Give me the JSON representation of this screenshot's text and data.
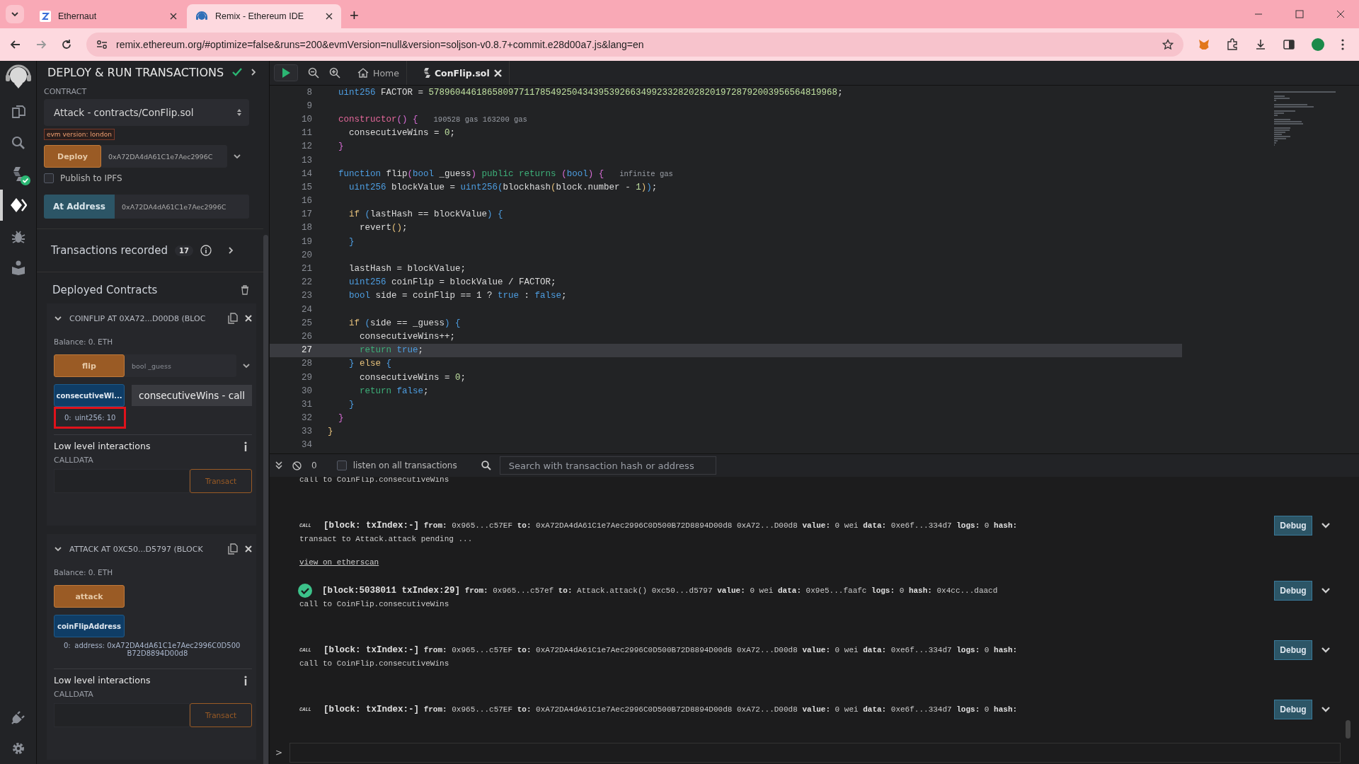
{
  "browser": {
    "tabs": [
      {
        "kind": "ethernaut",
        "title": "Ethernaut",
        "selected": false
      },
      {
        "kind": "remix",
        "title": "Remix - Ethereum IDE",
        "selected": true
      }
    ],
    "new_tab": "+",
    "url": "remix.ethereum.org/#optimize=false&runs=200&evmVersion=null&version=soljson-v0.8.7+commit.e28d00a7.js&lang=en"
  },
  "icon_panel": {
    "items": [
      {
        "kind": "files",
        "selected": false,
        "badge": false
      },
      {
        "kind": "search",
        "selected": false,
        "badge": false
      },
      {
        "kind": "compiler",
        "selected": false,
        "badge": true
      },
      {
        "kind": "deploy",
        "selected": true,
        "badge": false
      },
      {
        "kind": "debugger",
        "selected": false,
        "badge": false
      },
      {
        "kind": "learn",
        "selected": false,
        "badge": false
      }
    ],
    "bottom": [
      {
        "kind": "plugins"
      },
      {
        "kind": "settings"
      }
    ]
  },
  "side_panel": {
    "title": "DEPLOY & RUN TRANSACTIONS",
    "contract_label": "CONTRACT",
    "contract": "Attack - contracts/ConFlip.sol",
    "evm_badge": "evm version: london",
    "deploy": {
      "label": "Deploy",
      "value": "0xA72DA4dA61C1e7Aec2996C"
    },
    "publish": {
      "label": "Publish to IPFS",
      "checked": false
    },
    "at_address": {
      "label": "At Address",
      "value": "0xA72DA4dA61C1e7Aec2996C"
    },
    "transactions": {
      "label": "Transactions recorded",
      "count": "17"
    },
    "deployed_title": "Deployed Contracts",
    "instances": [
      {
        "title": "COINFLIP AT 0XA72...D00D8 (BLOC",
        "expanded": true,
        "balance": "Balance: 0. ETH",
        "functions": [
          {
            "kind": "transact",
            "label": "flip",
            "placeholder": "bool _guess"
          },
          {
            "kind": "call",
            "label": "consecutiveWi...",
            "tooltip": "consecutiveWins - call",
            "result_key": "0:",
            "result": "uint256: 10",
            "highlighted": true
          }
        ],
        "low_level": "Low level interactions",
        "calldata_label": "CALLDATA",
        "transact": "Transact"
      },
      {
        "title": "ATTACK AT 0XC50...D5797 (BLOCK",
        "expanded": true,
        "balance": "Balance: 0. ETH",
        "functions": [
          {
            "kind": "transact",
            "label": "attack"
          },
          {
            "kind": "call",
            "label": "coinFlipAddress",
            "result_key": "0:",
            "result": "address: 0xA72DA4dA61C1e7Aec2996C0D500B72D8894D00d8",
            "highlighted": false
          }
        ],
        "low_level": "Low level interactions",
        "calldata_label": "CALLDATA",
        "transact": "Transact"
      }
    ]
  },
  "editor": {
    "tabs": [
      {
        "kind": "home",
        "label": "Home",
        "selected": false
      },
      {
        "kind": "file",
        "label": "ConFlip.sol",
        "selected": true
      }
    ],
    "lines": [
      {
        "number": "8",
        "current": false,
        "tokens": [
          {
            "text": "  uint256",
            "kind": "type"
          },
          {
            "text": " FACTOR = ",
            "kind": "plain"
          },
          {
            "text": "57896044618658097711785492504343953926634992332820282019728792003956564819968",
            "kind": "number"
          },
          {
            "text": ";",
            "kind": "plain"
          }
        ]
      },
      {
        "number": "9",
        "current": false
      },
      {
        "number": "10",
        "current": false,
        "tokens": [
          {
            "text": "  constructor",
            "kind": "ctor"
          },
          {
            "text": "()",
            "kind": "bracket1"
          },
          {
            "text": " {",
            "kind": "bracket1"
          }
        ],
        "hint": "190528 gas 163200 gas"
      },
      {
        "number": "11",
        "current": false,
        "tokens": [
          {
            "text": "    consecutiveWins = ",
            "kind": "plain"
          },
          {
            "text": "0",
            "kind": "number"
          },
          {
            "text": ";",
            "kind": "plain"
          }
        ]
      },
      {
        "number": "12",
        "current": false,
        "tokens": [
          {
            "text": "  }",
            "kind": "bracket1"
          }
        ]
      },
      {
        "number": "13",
        "current": false
      },
      {
        "number": "14",
        "current": false,
        "tokens": [
          {
            "text": "  function",
            "kind": "type"
          },
          {
            "text": " flip",
            "kind": "plain"
          },
          {
            "text": "(",
            "kind": "bracket1"
          },
          {
            "text": "bool",
            "kind": "type"
          },
          {
            "text": " _guess",
            "kind": "plain"
          },
          {
            "text": ")",
            "kind": "bracket1"
          },
          {
            "text": " public returns ",
            "kind": "modifier"
          },
          {
            "text": "(",
            "kind": "bracket1"
          },
          {
            "text": "bool",
            "kind": "type"
          },
          {
            "text": ")",
            "kind": "bracket1"
          },
          {
            "text": " {",
            "kind": "bracket1"
          }
        ],
        "hint": "infinite gas"
      },
      {
        "number": "15",
        "current": false,
        "tokens": [
          {
            "text": "    uint256",
            "kind": "type"
          },
          {
            "text": " blockValue = ",
            "kind": "plain"
          },
          {
            "text": "uint256",
            "kind": "type"
          },
          {
            "text": "(",
            "kind": "bracket2"
          },
          {
            "text": "blockhash",
            "kind": "plain"
          },
          {
            "text": "(",
            "kind": "bracket3"
          },
          {
            "text": "block.number - ",
            "kind": "plain"
          },
          {
            "text": "1",
            "kind": "number"
          },
          {
            "text": ")",
            "kind": "bracket3"
          },
          {
            "text": ")",
            "kind": "bracket2"
          },
          {
            "text": ";",
            "kind": "plain"
          }
        ]
      },
      {
        "number": "16",
        "current": false
      },
      {
        "number": "17",
        "current": false,
        "tokens": [
          {
            "text": "    if",
            "kind": "control"
          },
          {
            "text": " (",
            "kind": "bracket2"
          },
          {
            "text": "lastHash == blockValue",
            "kind": "plain"
          },
          {
            "text": ")",
            "kind": "bracket2"
          },
          {
            "text": " {",
            "kind": "bracket2"
          }
        ]
      },
      {
        "number": "18",
        "current": false,
        "tokens": [
          {
            "text": "      revert",
            "kind": "plain"
          },
          {
            "text": "()",
            "kind": "bracket3"
          },
          {
            "text": ";",
            "kind": "plain"
          }
        ]
      },
      {
        "number": "19",
        "current": false,
        "tokens": [
          {
            "text": "    }",
            "kind": "bracket2"
          }
        ]
      },
      {
        "number": "20",
        "current": false
      },
      {
        "number": "21",
        "current": false,
        "tokens": [
          {
            "text": "    lastHash = blockValue;",
            "kind": "plain"
          }
        ]
      },
      {
        "number": "22",
        "current": false,
        "tokens": [
          {
            "text": "    uint256",
            "kind": "type"
          },
          {
            "text": " coinFlip = blockValue / FACTOR;",
            "kind": "plain"
          }
        ]
      },
      {
        "number": "23",
        "current": false,
        "tokens": [
          {
            "text": "    bool",
            "kind": "type"
          },
          {
            "text": " side = coinFlip == 1 ? ",
            "kind": "plain"
          },
          {
            "text": "true",
            "kind": "type"
          },
          {
            "text": " : ",
            "kind": "plain"
          },
          {
            "text": "false",
            "kind": "type"
          },
          {
            "text": ";",
            "kind": "plain"
          }
        ]
      },
      {
        "number": "24",
        "current": false
      },
      {
        "number": "25",
        "current": false,
        "tokens": [
          {
            "text": "    if",
            "kind": "control"
          },
          {
            "text": " (",
            "kind": "bracket2"
          },
          {
            "text": "side == _guess",
            "kind": "plain"
          },
          {
            "text": ")",
            "kind": "bracket2"
          },
          {
            "text": " {",
            "kind": "bracket2"
          }
        ]
      },
      {
        "number": "26",
        "current": false,
        "tokens": [
          {
            "text": "      consecutiveWins++;",
            "kind": "plain"
          }
        ]
      },
      {
        "number": "27",
        "current": true,
        "tokens": [
          {
            "text": "      return",
            "kind": "modifier"
          },
          {
            "text": " true",
            "kind": "type"
          },
          {
            "text": ";",
            "kind": "plain"
          }
        ]
      },
      {
        "number": "28",
        "current": false,
        "tokens": [
          {
            "text": "    }",
            "kind": "bracket2"
          },
          {
            "text": " else",
            "kind": "control"
          },
          {
            "text": " {",
            "kind": "bracket2"
          }
        ]
      },
      {
        "number": "29",
        "current": false,
        "tokens": [
          {
            "text": "      consecutiveWins = ",
            "kind": "plain"
          },
          {
            "text": "0",
            "kind": "number"
          },
          {
            "text": ";",
            "kind": "plain"
          }
        ]
      },
      {
        "number": "30",
        "current": false,
        "tokens": [
          {
            "text": "      return",
            "kind": "modifier"
          },
          {
            "text": " false",
            "kind": "type"
          },
          {
            "text": ";",
            "kind": "plain"
          }
        ]
      },
      {
        "number": "31",
        "current": false,
        "tokens": [
          {
            "text": "    }",
            "kind": "bracket2"
          }
        ]
      },
      {
        "number": "32",
        "current": false,
        "tokens": [
          {
            "text": "  }",
            "kind": "bracket1"
          }
        ]
      },
      {
        "number": "33",
        "current": false,
        "tokens": [
          {
            "text": "}",
            "kind": "bracket3"
          }
        ]
      },
      {
        "number": "34",
        "current": false
      }
    ]
  },
  "terminal": {
    "count": "0",
    "listen": {
      "label": "listen on all transactions",
      "checked": false
    },
    "search_placeholder": "Search with transaction hash or address",
    "entries": [
      {
        "kind": "text",
        "text": "call to CoinFlip.consecutiveWins"
      },
      {
        "kind": "call",
        "badge": "CALL",
        "block": "[block: txIndex:-]",
        "fields": [
          {
            "label": "from:",
            "value": "0x965...c57EF"
          },
          {
            "label": "to:",
            "value": "0xA72DA4dA61C1e7Aec2996C0D500B72D8894D00d8 0xA72...D00d8"
          },
          {
            "label": "value:",
            "value": "0 wei"
          },
          {
            "label": "data:",
            "value": "0xe6f...334d7"
          },
          {
            "label": "logs:",
            "value": "0"
          },
          {
            "label": "hash:"
          }
        ],
        "button": "Debug"
      },
      {
        "kind": "text",
        "text": "transact to Attack.attack pending ..."
      },
      {
        "kind": "link",
        "text": "view on etherscan"
      },
      {
        "kind": "success",
        "block": "[block:5038011 txIndex:29]",
        "fields": [
          {
            "label": "from:",
            "value": "0x965...c57ef"
          },
          {
            "label": "to:",
            "value": "Attack.attack() 0xc50...d5797"
          },
          {
            "label": "value:",
            "value": "0 wei"
          },
          {
            "label": "data:",
            "value": "0x9e5...faafc"
          },
          {
            "label": "logs:",
            "value": "0"
          },
          {
            "label": "hash:",
            "value": "0x4cc...daacd"
          }
        ],
        "button": "Debug"
      },
      {
        "kind": "text",
        "text": "call to CoinFlip.consecutiveWins"
      },
      {
        "kind": "call",
        "badge": "CALL",
        "block": "[block: txIndex:-]",
        "fields": [
          {
            "label": "from:",
            "value": "0x965...c57EF"
          },
          {
            "label": "to:",
            "value": "0xA72DA4dA61C1e7Aec2996C0D500B72D8894D00d8 0xA72...D00d8"
          },
          {
            "label": "value:",
            "value": "0 wei"
          },
          {
            "label": "data:",
            "value": "0xe6f...334d7"
          },
          {
            "label": "logs:",
            "value": "0"
          },
          {
            "label": "hash:"
          }
        ],
        "button": "Debug"
      },
      {
        "kind": "text",
        "text": "call to CoinFlip.consecutiveWins"
      },
      {
        "kind": "call",
        "badge": "CALL",
        "block": "[block: txIndex:-]",
        "fields": [
          {
            "label": "from:",
            "value": "0x965...c57EF"
          },
          {
            "label": "to:",
            "value": "0xA72DA4dA61C1e7Aec2996C0D500B72D8894D00d8 0xA72...D00d8"
          },
          {
            "label": "value:",
            "value": "0 wei"
          },
          {
            "label": "data:",
            "value": "0xe6f...334d7"
          },
          {
            "label": "logs:",
            "value": "0"
          },
          {
            "label": "hash:"
          }
        ],
        "button": "Debug"
      }
    ],
    "prompt": ">"
  }
}
